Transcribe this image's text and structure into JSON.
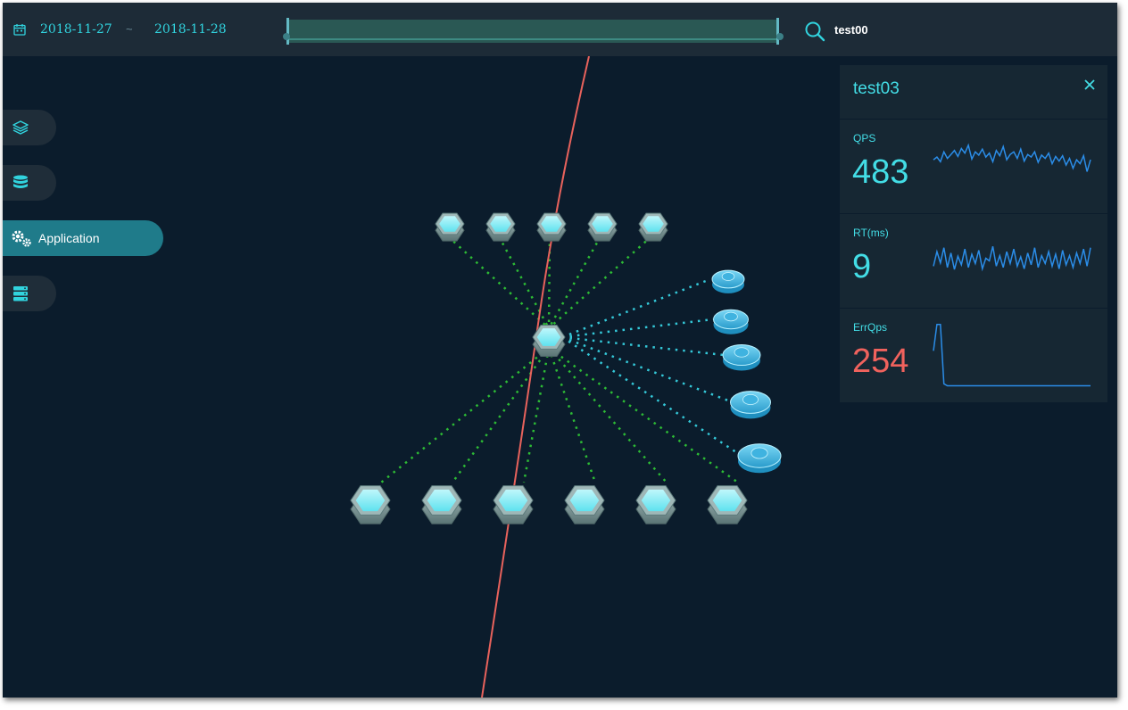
{
  "topbar": {
    "calendar_icon": "calendar-icon",
    "start_date": "2018-11-27",
    "separator": "~",
    "end_date": "2018-11-28",
    "time_range_fraction": [
      0.0,
      1.0
    ],
    "search_icon": "search-icon",
    "search_value": "test00"
  },
  "sidebar": {
    "items": [
      {
        "icon": "layers-icon",
        "label": "",
        "active": false
      },
      {
        "icon": "database-icon",
        "label": "",
        "active": false
      },
      {
        "icon": "gears-icon",
        "label": "Application",
        "active": true
      },
      {
        "icon": "server-icon",
        "label": "",
        "active": false
      }
    ]
  },
  "colors": {
    "background": "#0b1c2c",
    "topbar": "#1d2b37",
    "accent": "#43dde6",
    "error": "#f0625d",
    "sparkline": "#2b8de8",
    "link_green": "#2dbb35",
    "link_cyan": "#34c8d8",
    "trace_red": "#e8625c"
  },
  "topology": {
    "center_node": "hexagon-node",
    "upstream_nodes": 5,
    "downstream_nodes": 6,
    "dependency_nodes": [
      "cache-icon",
      "mq-icon",
      "database-icon",
      "storage-icon",
      "db-icon"
    ]
  },
  "detail_panel": {
    "title": "test03",
    "close_icon": "close-icon",
    "metrics": [
      {
        "label": "QPS",
        "value": "483",
        "error": false,
        "series": [
          58,
          62,
          55,
          70,
          60,
          66,
          72,
          63,
          75,
          68,
          80,
          59,
          70,
          65,
          74,
          62,
          68,
          55,
          72,
          64,
          78,
          58,
          66,
          70,
          60,
          74,
          56,
          66,
          62,
          70,
          54,
          65,
          60,
          68,
          52,
          63,
          56,
          64,
          50,
          60,
          45,
          58,
          52,
          64,
          40,
          58
        ]
      },
      {
        "label": "RT(ms)",
        "value": "9",
        "error": false,
        "series": [
          40,
          62,
          45,
          68,
          38,
          60,
          35,
          55,
          42,
          66,
          38,
          58,
          44,
          64,
          36,
          52,
          48,
          70,
          40,
          56,
          38,
          62,
          44,
          66,
          40,
          54,
          36,
          60,
          42,
          68,
          38,
          56,
          44,
          62,
          40,
          58,
          36,
          64,
          42,
          56,
          38,
          60,
          44,
          66,
          40,
          68
        ]
      },
      {
        "label": "ErrQps",
        "value": "254",
        "error": true,
        "series": [
          55,
          95,
          95,
          5,
          2,
          2,
          2,
          2,
          2,
          2,
          2,
          2,
          2,
          2,
          2,
          2,
          2,
          2,
          2,
          2,
          2,
          2,
          2,
          2,
          2,
          2,
          2,
          2,
          2,
          2,
          2,
          2,
          2,
          2,
          2,
          2,
          2,
          2,
          2,
          2,
          2,
          2,
          2,
          2,
          2,
          2
        ]
      }
    ]
  }
}
